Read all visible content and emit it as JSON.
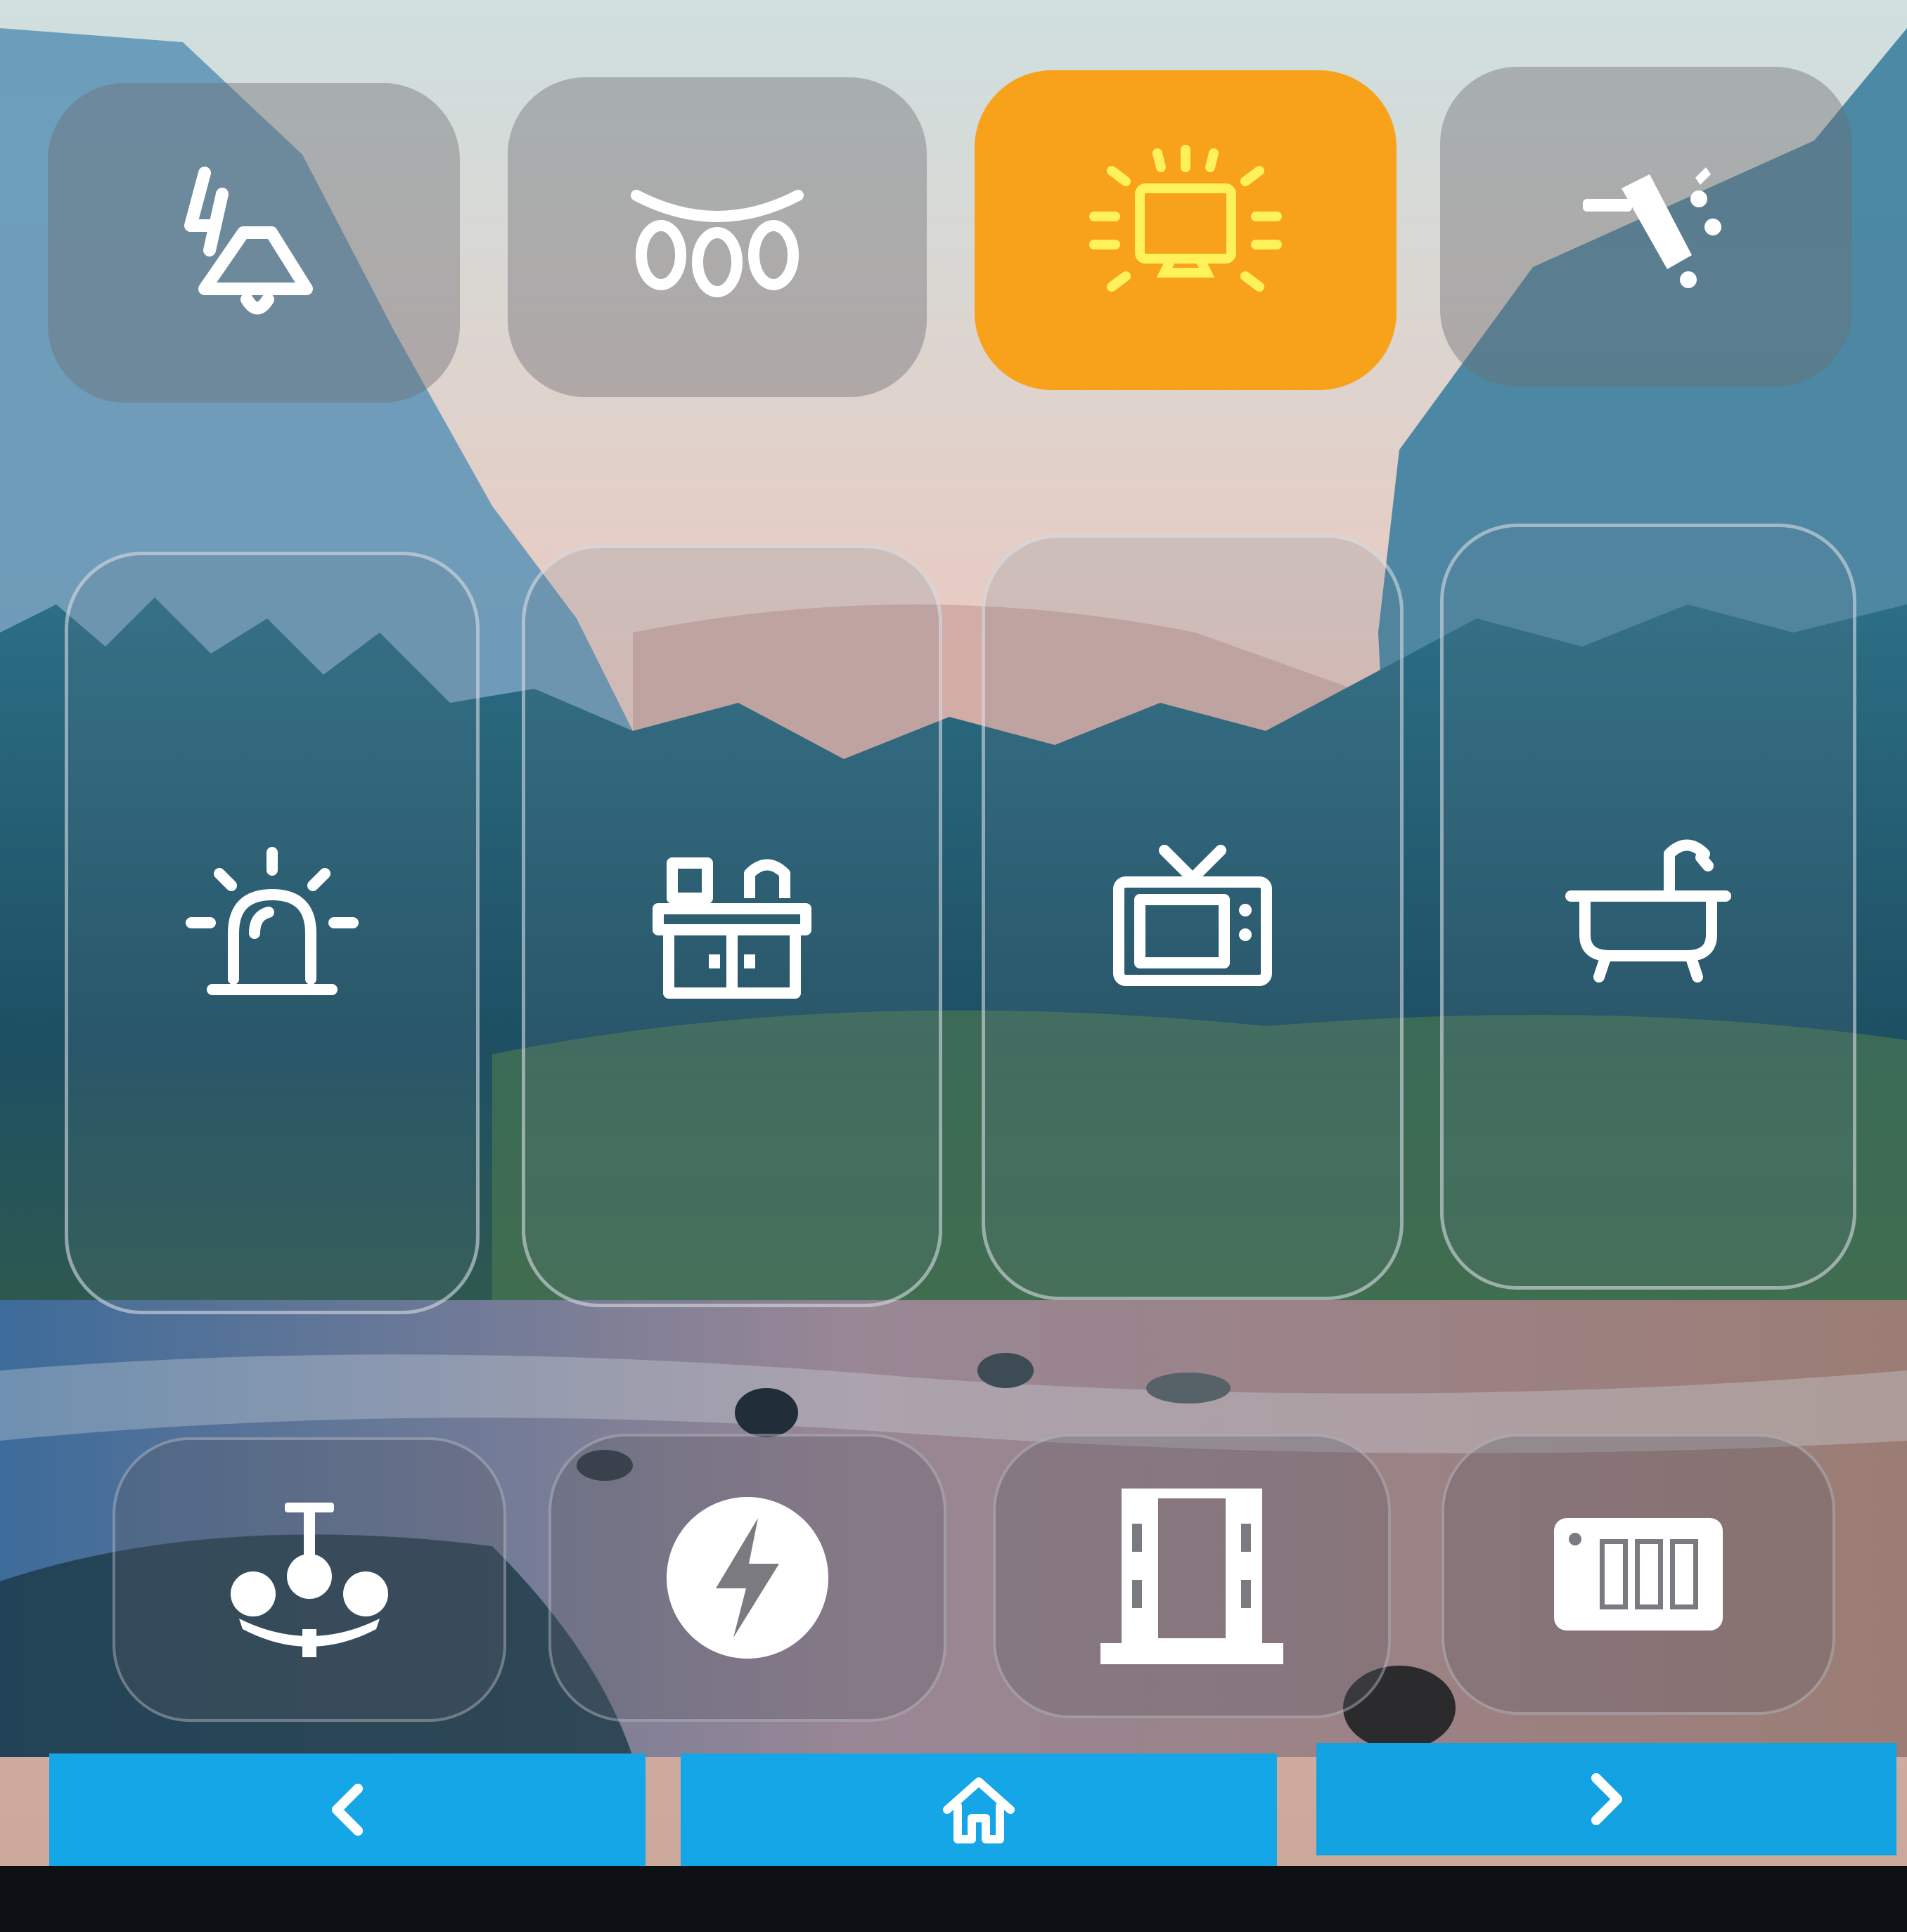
{
  "colors": {
    "active_tile": "#f8a21c",
    "active_icon": "#fff15a",
    "icon": "#ffffff",
    "nav_button": "#14a6e6"
  },
  "tiles": {
    "row1": [
      {
        "icon": "pendant-lamp-icon",
        "active": false
      },
      {
        "icon": "string-lights-icon",
        "active": false
      },
      {
        "icon": "screen-light-icon",
        "active": true
      },
      {
        "icon": "spotlight-icon",
        "active": false
      }
    ],
    "row2": [
      {
        "icon": "alarm-siren-icon"
      },
      {
        "icon": "kitchen-cabinet-icon"
      },
      {
        "icon": "tv-icon"
      },
      {
        "icon": "bathtub-icon"
      }
    ],
    "row3": [
      {
        "icon": "chandelier-icon"
      },
      {
        "icon": "power-icon"
      },
      {
        "icon": "window-icon"
      },
      {
        "icon": "wall-switch-icon"
      }
    ]
  },
  "nav": [
    {
      "icon": "chevron-left-icon"
    },
    {
      "icon": "home-icon"
    },
    {
      "icon": "chevron-right-icon"
    }
  ]
}
